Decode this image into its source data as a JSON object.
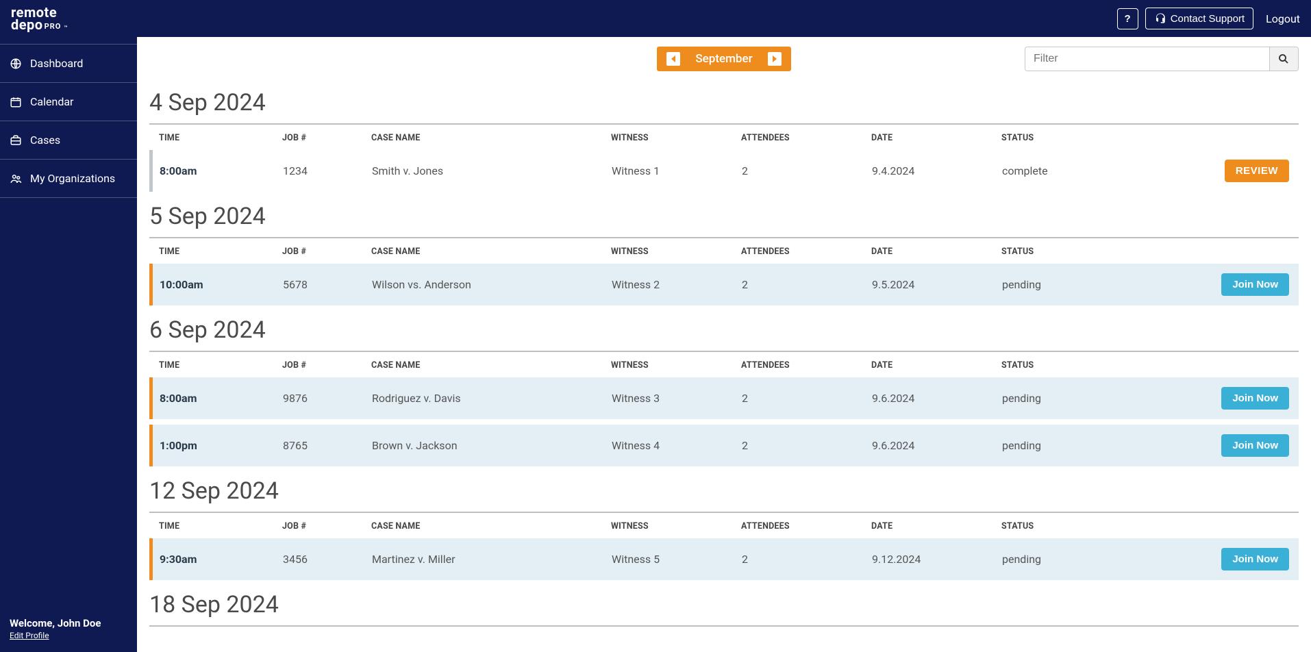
{
  "header": {
    "logo_line1": "remote",
    "logo_line2": "depo",
    "logo_pro": "PRO",
    "logo_tm": "™",
    "help_label": "?",
    "contact_label": "Contact Support",
    "logout_label": "Logout"
  },
  "sidebar": {
    "items": [
      {
        "id": "dashboard",
        "label": "Dashboard"
      },
      {
        "id": "calendar",
        "label": "Calendar"
      },
      {
        "id": "cases",
        "label": "Cases"
      },
      {
        "id": "orgs",
        "label": "My Organizations"
      }
    ],
    "welcome": "Welcome, John Doe",
    "edit_profile": "Edit Profile"
  },
  "toolbar": {
    "month": "September",
    "filter_placeholder": "Filter"
  },
  "columns": {
    "time": "TIME",
    "job": "JOB #",
    "case": "CASE NAME",
    "witness": "WITNESS",
    "attendees": "ATTENDEES",
    "date": "DATE",
    "status": "STATUS"
  },
  "actions": {
    "review": "REVIEW",
    "join": "Join Now"
  },
  "days": [
    {
      "title": "4 Sep 2024",
      "rows": [
        {
          "time": "8:00am",
          "job": "1234",
          "case": "Smith v. Jones",
          "witness": "Witness 1",
          "attendees": "2",
          "date": "9.4.2024",
          "status": "complete",
          "action": "review"
        }
      ]
    },
    {
      "title": "5 Sep 2024",
      "rows": [
        {
          "time": "10:00am",
          "job": "5678",
          "case": "Wilson vs. Anderson",
          "witness": "Witness 2",
          "attendees": "2",
          "date": "9.5.2024",
          "status": "pending",
          "action": "join"
        }
      ]
    },
    {
      "title": "6 Sep 2024",
      "rows": [
        {
          "time": "8:00am",
          "job": "9876",
          "case": "Rodriguez v. Davis",
          "witness": "Witness 3",
          "attendees": "2",
          "date": "9.6.2024",
          "status": "pending",
          "action": "join"
        },
        {
          "time": "1:00pm",
          "job": "8765",
          "case": "Brown v. Jackson",
          "witness": "Witness 4",
          "attendees": "2",
          "date": "9.6.2024",
          "status": "pending",
          "action": "join"
        }
      ]
    },
    {
      "title": "12 Sep 2024",
      "rows": [
        {
          "time": "9:30am",
          "job": "3456",
          "case": "Martinez v. Miller",
          "witness": "Witness 5",
          "attendees": "2",
          "date": "9.12.2024",
          "status": "pending",
          "action": "join"
        }
      ]
    },
    {
      "title": "18 Sep 2024",
      "rows": []
    }
  ]
}
